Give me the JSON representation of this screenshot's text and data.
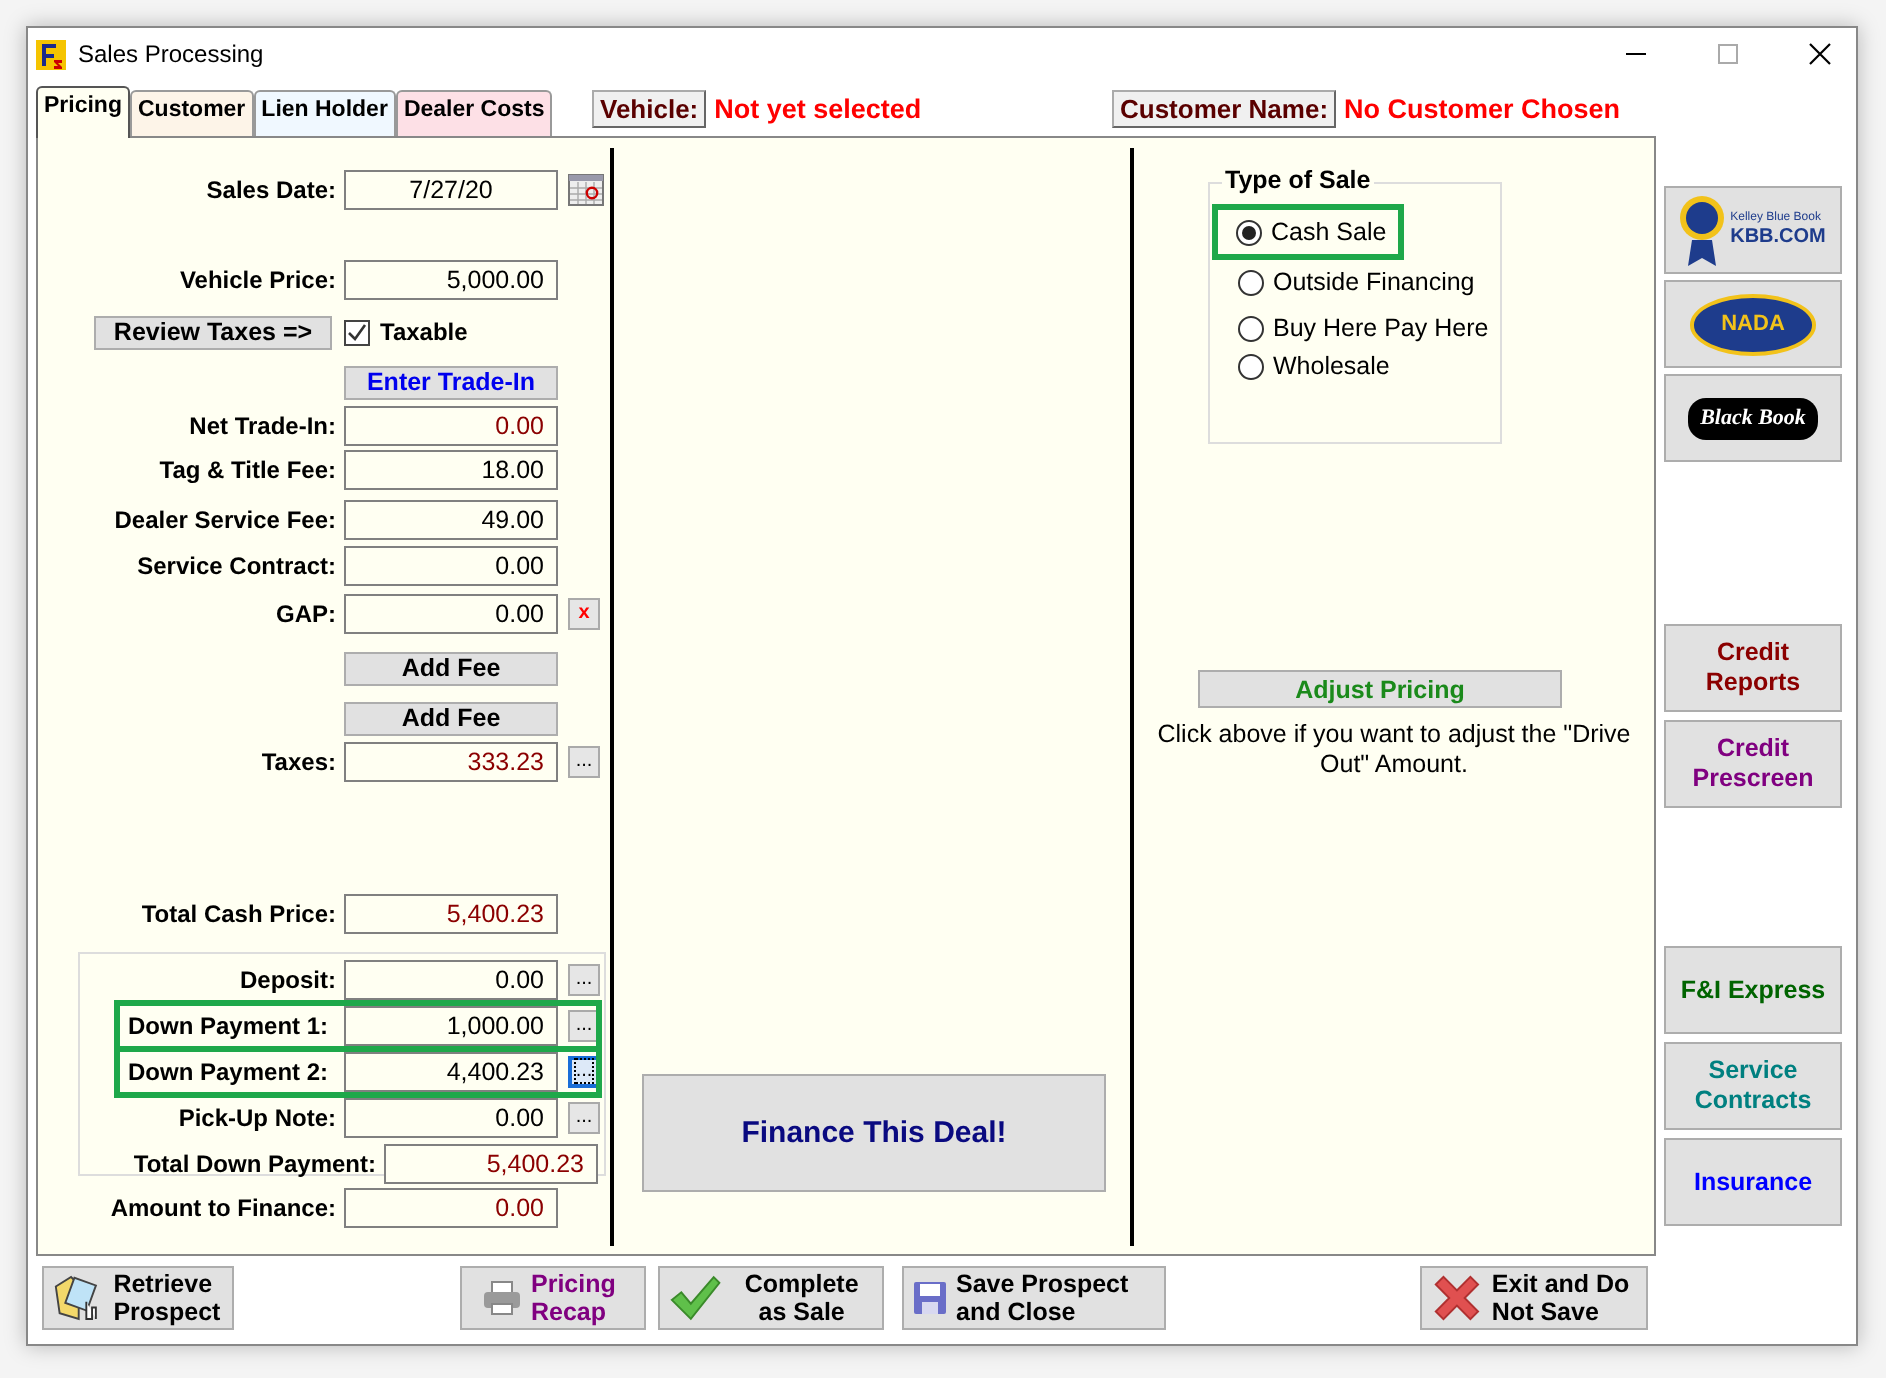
{
  "window": {
    "title": "Sales Processing"
  },
  "tabs": [
    {
      "label": "Pricing",
      "selected": true,
      "color": "#fffff2"
    },
    {
      "label": "Customer",
      "selected": false,
      "color": "#fdf4e8"
    },
    {
      "label": "Lien Holder",
      "selected": false,
      "color": "#f0f8ff"
    },
    {
      "label": "Dealer Costs",
      "selected": false,
      "color": "#fde0e6"
    }
  ],
  "vehicle": {
    "label": "Vehicle:",
    "value": "Not yet selected"
  },
  "customer": {
    "label": "Customer Name:",
    "value": "No Customer Chosen"
  },
  "pricing_rows": [
    {
      "kind": "date",
      "label": "Sales Date:",
      "value": "7/27/20"
    },
    {
      "kind": "field",
      "label": "Vehicle Price:",
      "value": "5,000.00",
      "readonly": false
    },
    {
      "kind": "tax",
      "button": "Review Taxes =>",
      "checkbox": {
        "label": "Taxable",
        "checked": true
      }
    },
    {
      "kind": "button",
      "label": "Enter Trade-In",
      "color": "#0000ee"
    },
    {
      "kind": "field",
      "label": "Net Trade-In:",
      "value": "0.00",
      "readonly": true
    },
    {
      "kind": "field",
      "label": "Tag & Title Fee:",
      "value": "18.00",
      "readonly": false
    },
    {
      "kind": "field",
      "label": "Dealer Service Fee:",
      "value": "49.00",
      "readonly": false
    },
    {
      "kind": "field",
      "label": "Service Contract:",
      "value": "0.00",
      "readonly": false
    },
    {
      "kind": "field",
      "label": "GAP:",
      "value": "0.00",
      "readonly": false,
      "side": "x"
    },
    {
      "kind": "button",
      "label": "Add Fee",
      "color": "#000000"
    },
    {
      "kind": "button",
      "label": "Add Fee",
      "color": "#000000"
    },
    {
      "kind": "field",
      "label": "Taxes:",
      "value": "333.23",
      "readonly": true,
      "side": "..."
    },
    {
      "kind": "field",
      "label": "Total Cash Price:",
      "value": "5,400.23",
      "readonly": true
    }
  ],
  "down_payments": [
    {
      "label": "Deposit:",
      "value": "0.00",
      "readonly": false,
      "side": "...",
      "highlighted": false,
      "focused": false
    },
    {
      "label": "Down Payment 1:",
      "value": "1,000.00",
      "readonly": false,
      "side": "...",
      "highlighted": true,
      "focused": false
    },
    {
      "label": "Down Payment 2:",
      "value": "4,400.23",
      "readonly": false,
      "side": "...",
      "highlighted": true,
      "focused": true
    },
    {
      "label": "Pick-Up Note:",
      "value": "0.00",
      "readonly": false,
      "side": "...",
      "highlighted": false,
      "focused": false
    },
    {
      "label": "Total Down Payment:",
      "value": "5,400.23",
      "readonly": true,
      "highlighted": false
    }
  ],
  "amount_to_finance": {
    "label": "Amount to Finance:",
    "value": "0.00",
    "readonly": true
  },
  "finance_button": "Finance This Deal!",
  "type_of_sale": {
    "title": "Type of Sale",
    "options": [
      {
        "label": "Cash Sale",
        "selected": true,
        "highlighted": true
      },
      {
        "label": "Outside Financing",
        "selected": false,
        "highlighted": false
      },
      {
        "label": "Buy Here Pay Here",
        "selected": false,
        "highlighted": false
      },
      {
        "label": "Wholesale",
        "selected": false,
        "highlighted": false
      }
    ]
  },
  "adjust_pricing": {
    "button": "Adjust Pricing",
    "note": "Click above if you want to adjust the \"Drive Out\" Amount."
  },
  "sidebar": {
    "logos": [
      {
        "kind": "kbb",
        "text": "KBB.COM",
        "caption": "Kelley Blue Book"
      },
      {
        "kind": "nada",
        "text": "NADA"
      },
      {
        "kind": "blackbook",
        "text": "Black Book"
      }
    ],
    "credit": [
      {
        "label": "Credit Reports",
        "color": "#8b0000"
      },
      {
        "label": "Credit Prescreen",
        "color": "#800080"
      }
    ],
    "extras": [
      {
        "label": "F&I Express",
        "color": "#006400"
      },
      {
        "label": "Service Contracts",
        "color": "#008080"
      },
      {
        "label": "Insurance",
        "color": "#0000ff"
      }
    ]
  },
  "bottom_buttons": [
    {
      "label": "Retrieve Prospect",
      "color": "#000000"
    },
    {
      "label": "Pricing Recap",
      "color": "#800080"
    },
    {
      "label": "Complete as Sale",
      "color": "#000000"
    },
    {
      "label": "Save Prospect and Close",
      "color": "#000000"
    },
    {
      "label": "Exit and Do Not Save",
      "color": "#000000"
    }
  ]
}
